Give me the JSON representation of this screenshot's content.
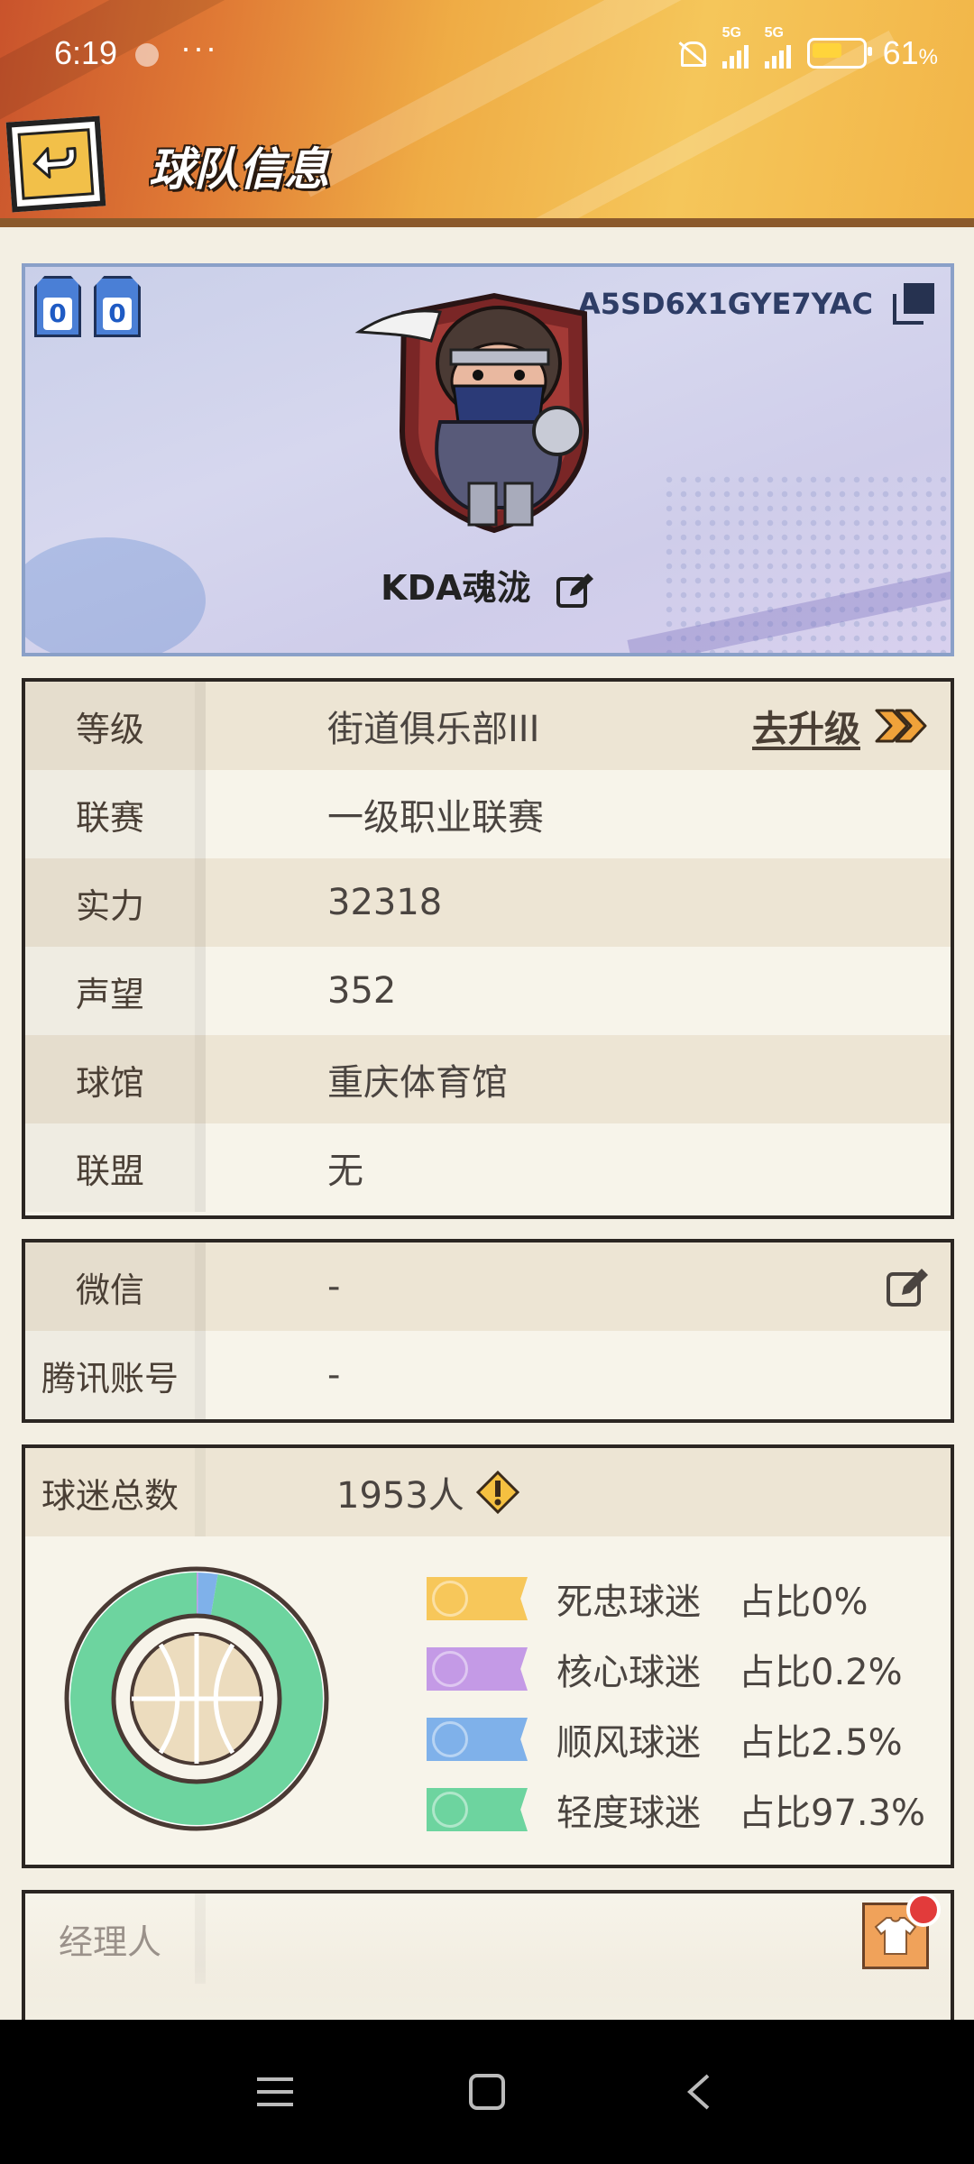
{
  "status_bar": {
    "time": "6:19",
    "more": "···",
    "signal1_label": "5G",
    "signal2_label": "5G",
    "battery": "61",
    "battery_unit": "%"
  },
  "header": {
    "title": "球队信息"
  },
  "profile": {
    "jerseys": [
      "0",
      "0"
    ],
    "team_code": "A5SD6X1GYE7YAC",
    "team_name": "KDA魂泷"
  },
  "info": {
    "rows": [
      {
        "key": "等级",
        "value": "街道俱乐部III"
      },
      {
        "key": "联赛",
        "value": "一级职业联赛"
      },
      {
        "key": "实力",
        "value": "32318"
      },
      {
        "key": "声望",
        "value": "352"
      },
      {
        "key": "球馆",
        "value": "重庆体育馆"
      },
      {
        "key": "联盟",
        "value": "无"
      }
    ],
    "upgrade_label": "去升级"
  },
  "contact": {
    "rows": [
      {
        "key": "微信",
        "value": "-"
      },
      {
        "key": "腾讯账号",
        "value": "-"
      }
    ]
  },
  "fans": {
    "key": "球迷总数",
    "total": "1953人",
    "legend": [
      {
        "name": "死忠球迷",
        "pct": "占比0%",
        "color": "#f7c75a",
        "share": 0
      },
      {
        "name": "核心球迷",
        "pct": "占比0.2%",
        "color": "#c49ae6",
        "share": 0.2
      },
      {
        "name": "顺风球迷",
        "pct": "占比2.5%",
        "color": "#7fb1ea",
        "share": 2.5
      },
      {
        "name": "轻度球迷",
        "pct": "占比97.3%",
        "color": "#6dd49f",
        "share": 97.3
      }
    ]
  },
  "manager": {
    "key": "经理人"
  }
}
